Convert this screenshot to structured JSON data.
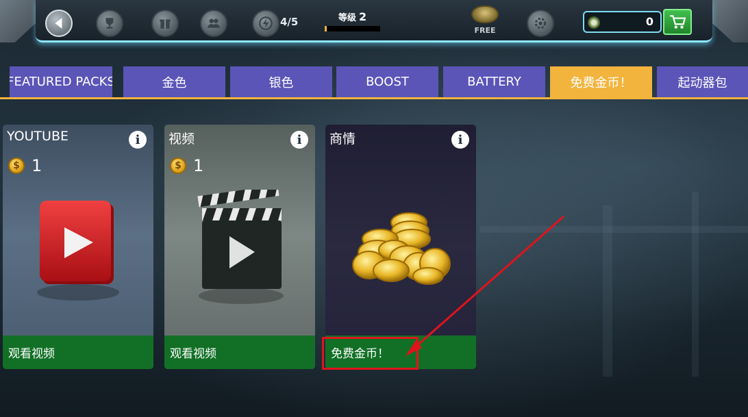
{
  "topbar": {
    "energy": "4/5",
    "level_label": "等级",
    "level_value": "2",
    "level_progress": 0.04,
    "free_label": "FREE",
    "currency_value": "0"
  },
  "tabs": [
    {
      "label": "FEATURED PACKS",
      "active": false
    },
    {
      "label": "金色",
      "active": false
    },
    {
      "label": "银色",
      "active": false
    },
    {
      "label": "BOOST",
      "active": false
    },
    {
      "label": "BATTERY",
      "active": false
    },
    {
      "label": "免费金币！",
      "active": true
    },
    {
      "label": "起动器包",
      "active": false
    }
  ],
  "cards": [
    {
      "title": "YOUTUBE",
      "price": "1",
      "footer": "观看视频",
      "art": "youtube-play-icon"
    },
    {
      "title": "视频",
      "price": "1",
      "footer": "观看视频",
      "art": "clapperboard-icon"
    },
    {
      "title": "商情",
      "footer": "免费金币！",
      "art": "gold-coins-pile"
    }
  ],
  "colors": {
    "tab": "#5b55b8",
    "tab_active": "#f3b43d",
    "card_footer": "#127026",
    "annotation": "#e0141b"
  }
}
